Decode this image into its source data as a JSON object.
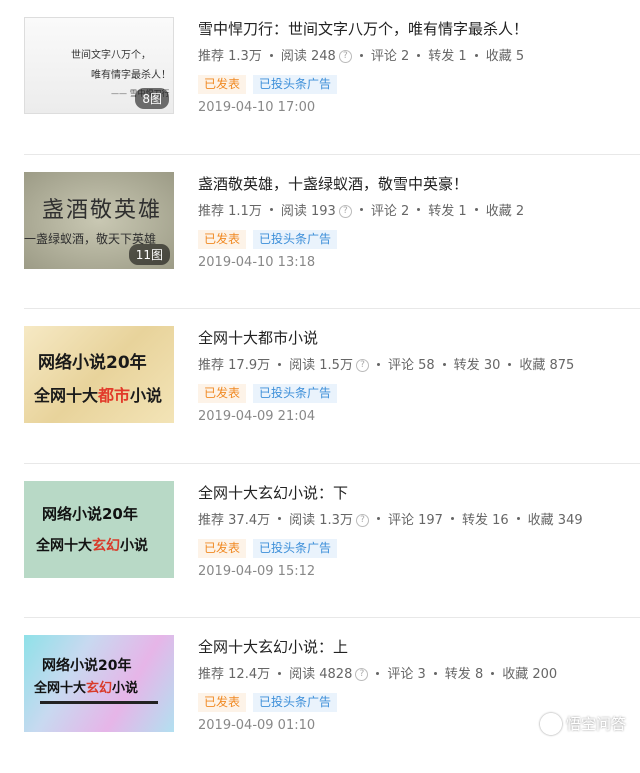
{
  "articles": [
    {
      "title": "雪中悍刀行：世间文字八万个，唯有情字最杀人！",
      "stats": {
        "recommend_label": "推荐",
        "recommend": "1.3万",
        "read_label": "阅读",
        "read": "248",
        "comment_label": "评论",
        "comment": "2",
        "share_label": "转发",
        "share": "1",
        "fav_label": "收藏",
        "fav": "5"
      },
      "tag_published": "已发表",
      "tag_ad": "已投头条广告",
      "time": "2019-04-10 17:00",
      "image_count": "8图",
      "thumb_text": {
        "line1": "世间文字八万个，",
        "line2": "唯有情字最杀人！",
        "sig": "—— 雪中悍刀行"
      }
    },
    {
      "title": "盏酒敬英雄，十盏绿蚁酒，敬雪中英豪！",
      "stats": {
        "recommend_label": "推荐",
        "recommend": "1.1万",
        "read_label": "阅读",
        "read": "193",
        "comment_label": "评论",
        "comment": "2",
        "share_label": "转发",
        "share": "1",
        "fav_label": "收藏",
        "fav": "2"
      },
      "tag_published": "已发表",
      "tag_ad": "已投头条广告",
      "time": "2019-04-10 13:18",
      "image_count": "11图",
      "thumb_text": {
        "line1": "盏酒敬英雄",
        "line2": "一盏绿蚁酒，敬天下英雄"
      }
    },
    {
      "title": "全网十大都市小说",
      "stats": {
        "recommend_label": "推荐",
        "recommend": "17.9万",
        "read_label": "阅读",
        "read": "1.5万",
        "comment_label": "评论",
        "comment": "58",
        "share_label": "转发",
        "share": "30",
        "fav_label": "收藏",
        "fav": "875"
      },
      "tag_published": "已发表",
      "tag_ad": "已投头条广告",
      "time": "2019-04-09 21:04",
      "thumb_text": {
        "line1": "网络小说20年",
        "line2_a": "全网十大",
        "line2_b": "都市",
        "line2_c": "小说"
      }
    },
    {
      "title": "全网十大玄幻小说：下",
      "stats": {
        "recommend_label": "推荐",
        "recommend": "37.4万",
        "read_label": "阅读",
        "read": "1.3万",
        "comment_label": "评论",
        "comment": "197",
        "share_label": "转发",
        "share": "16",
        "fav_label": "收藏",
        "fav": "349"
      },
      "tag_published": "已发表",
      "tag_ad": "已投头条广告",
      "time": "2019-04-09 15:12",
      "thumb_text": {
        "line1": "网络小说20年",
        "line2_a": "全网十大",
        "line2_b": "玄幻",
        "line2_c": "小说"
      }
    },
    {
      "title": "全网十大玄幻小说：上",
      "stats": {
        "recommend_label": "推荐",
        "recommend": "12.4万",
        "read_label": "阅读",
        "read": "4828",
        "comment_label": "评论",
        "comment": "3",
        "share_label": "转发",
        "share": "8",
        "fav_label": "收藏",
        "fav": "200"
      },
      "tag_published": "已发表",
      "tag_ad": "已投头条广告",
      "time": "2019-04-09 01:10",
      "thumb_text": {
        "line1": "网络小说20年",
        "line2_a": "全网十大",
        "line2_b": "玄幻",
        "line2_c": "小说"
      }
    }
  ],
  "watermark": "悟空问答",
  "help_glyph": "?"
}
